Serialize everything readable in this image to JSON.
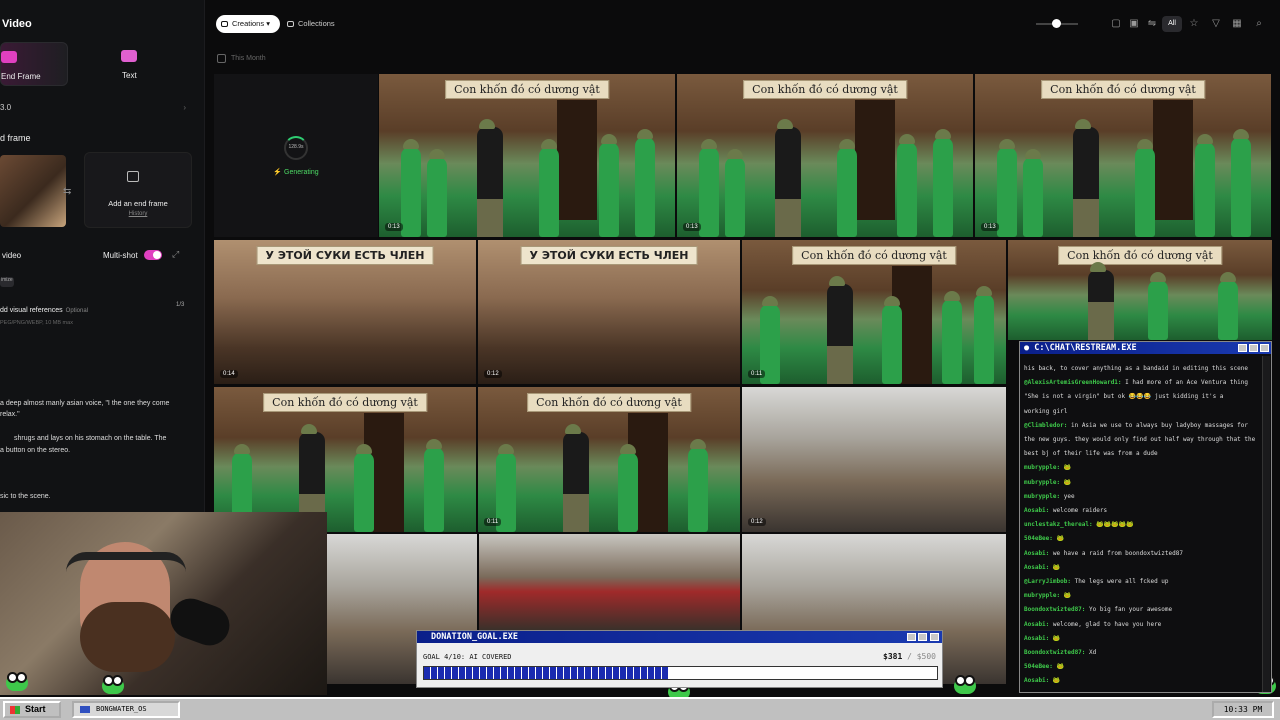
{
  "left_panel": {
    "title": "Video",
    "mode_tabs": [
      {
        "label": "End Frame",
        "icon": "frames-icon",
        "color": "#e040c0"
      },
      {
        "label": "Text",
        "icon": "text-icon",
        "color": "#e060d0"
      }
    ],
    "model_value": "3.0",
    "frame_label": "d frame",
    "end_frame_label": "Add an end frame",
    "history_label": "History",
    "video_label": "video",
    "multishot_label": "Multi-shot",
    "multishot_on": true,
    "optimize_label": "imize",
    "refs_label": "dd visual references",
    "refs_optional": "Optional",
    "refs_count": "1/3",
    "refs_sub": "PEG/PNG/WEBP, 10 MB max",
    "prompt_lines": [
      "a deep almost manly asian voice, \"I the one they come",
      "relax.\"",
      "shrugs and lays on his stomach on the table. The",
      "a button on the stereo.",
      "sic to the scene."
    ]
  },
  "toolbar": {
    "creations_label": "Creations",
    "collections_label": "Collections",
    "all_label": "All",
    "filter_label": "This Month",
    "zoom_slider": 0.45
  },
  "generating": {
    "percent": "128.9s",
    "label": "Generating"
  },
  "thumbs": {
    "banner_vi": "Con khốn đó có dương vật",
    "banner_ru": "У ЭТОЙ СУКИ ЕСТЬ ЧЛЕН",
    "durations": [
      "0:13",
      "0:13",
      "0:13",
      "0:14",
      "0:12",
      "0:11",
      "0:11",
      "0:12"
    ]
  },
  "chat": {
    "title": "C:\\CHAT\\RESTREAM.EXE",
    "messages": [
      {
        "user": "",
        "text": "his back, to cover anything as a bandaid in editing this scene"
      },
      {
        "user": "@AlexisArtemisGreenHoward1:",
        "text": "I had more of an Ace Ventura thing"
      },
      {
        "user": "",
        "text": "\"She is not a virgin\" but ok 😂😂😂 just kidding it's a"
      },
      {
        "user": "",
        "text": "working girl"
      },
      {
        "user": "@Climbledor:",
        "text": "in Asia we use to always buy ladyboy massages for"
      },
      {
        "user": "",
        "text": "the new guys. they would only find out half way through that the"
      },
      {
        "user": "",
        "text": "best bj of their life was from a dude"
      },
      {
        "user": "mubrypple:",
        "text": "🐸"
      },
      {
        "user": "mubrypple:",
        "text": "🐸"
      },
      {
        "user": "mubrypple:",
        "text": "yee"
      },
      {
        "user": "Aosabi:",
        "text": "welcome raiders"
      },
      {
        "user": "unclestakz_thereal:",
        "text": "🐸🐸🐸🐸🐸"
      },
      {
        "user": "504eBee:",
        "text": "🐸"
      },
      {
        "user": "Aosabi:",
        "text": "we have a raid from boondoxtwizted87"
      },
      {
        "user": "Aosabi:",
        "text": "🐸"
      },
      {
        "user": "@LarryJimbob:",
        "text": "The legs were all fcked up"
      },
      {
        "user": "mubrypple:",
        "text": "🐸"
      },
      {
        "user": "Boondoxtwizted87:",
        "text": "Yo big fan your awesome"
      },
      {
        "user": "Aosabi:",
        "text": "welcome, glad to have you here"
      },
      {
        "user": "Aosabi:",
        "text": "🐸"
      },
      {
        "user": "Boondoxtwizted87:",
        "text": "Xd"
      },
      {
        "user": "504eBee:",
        "text": "🐸"
      },
      {
        "user": "Aosabi:",
        "text": "🐸"
      }
    ]
  },
  "donation": {
    "title": "DONATION_GOAL.EXE",
    "goal": "GOAL 4/10: AI COVERED",
    "amount": "$381",
    "total": "/ $500",
    "progress": 0.476,
    "color": "#1a2bb0"
  },
  "taskbar": {
    "start_label": "Start",
    "task_label": "BONGWATER_OS",
    "clock": "10:33 PM"
  }
}
